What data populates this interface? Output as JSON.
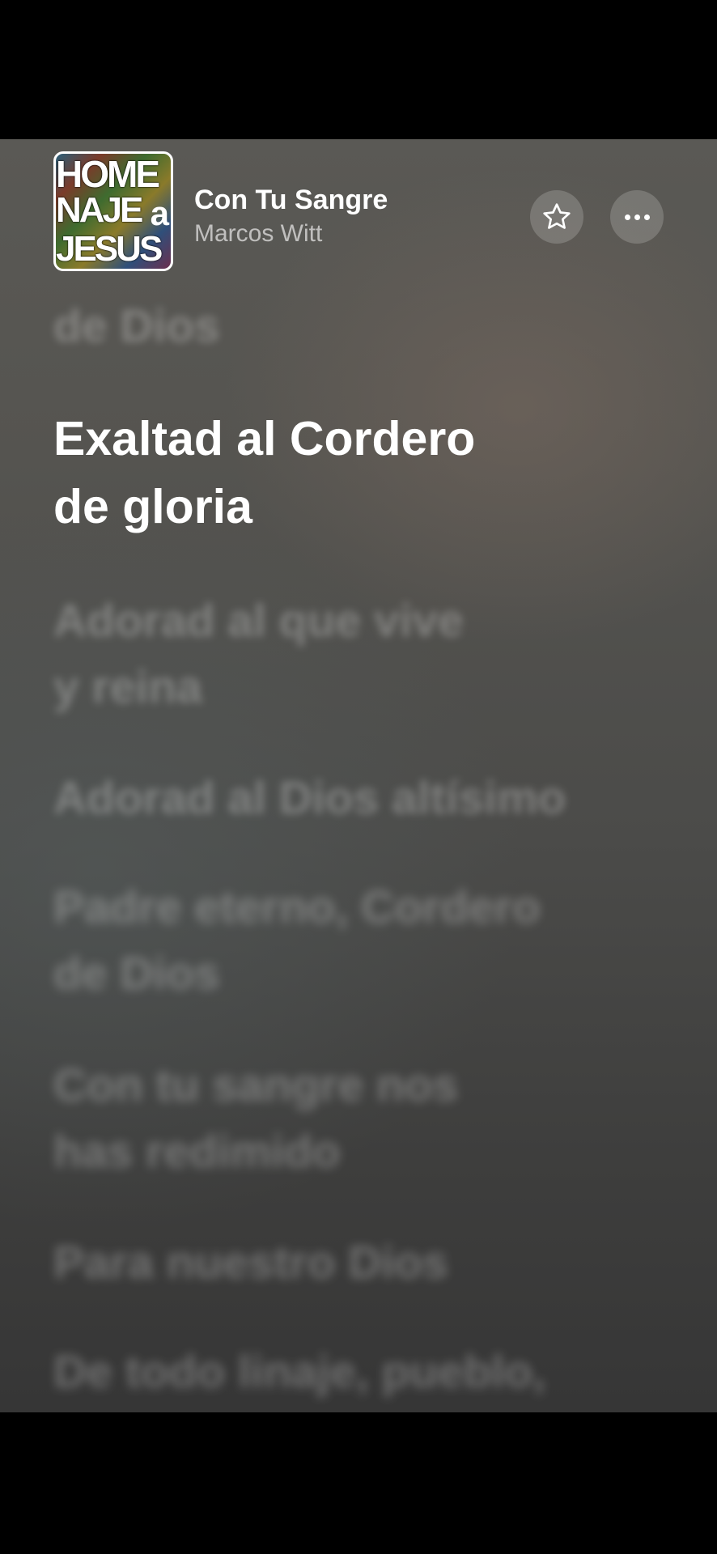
{
  "now_playing": {
    "artwork_text": [
      "HOME",
      "NAJE",
      "JESUS"
    ],
    "artwork_letter": "a",
    "title": "Con Tu Sangre",
    "artist": "Marcos Witt"
  },
  "icons": {
    "favorite": "star-icon",
    "more": "ellipsis-icon"
  },
  "lyrics": {
    "previous": [
      "de Dios"
    ],
    "current": [
      "Exaltad al Cordero",
      "de gloria"
    ],
    "upcoming": [
      [
        "Adorad al que vive",
        "y reina"
      ],
      [
        "Adorad al Dios altísimo"
      ],
      [
        "Padre eterno, Cordero",
        "de Dios"
      ],
      [
        "Con tu sangre nos",
        "has redimido"
      ],
      [
        "Para nuestro Dios"
      ],
      [
        "De todo linaje, pueblo,"
      ]
    ]
  }
}
